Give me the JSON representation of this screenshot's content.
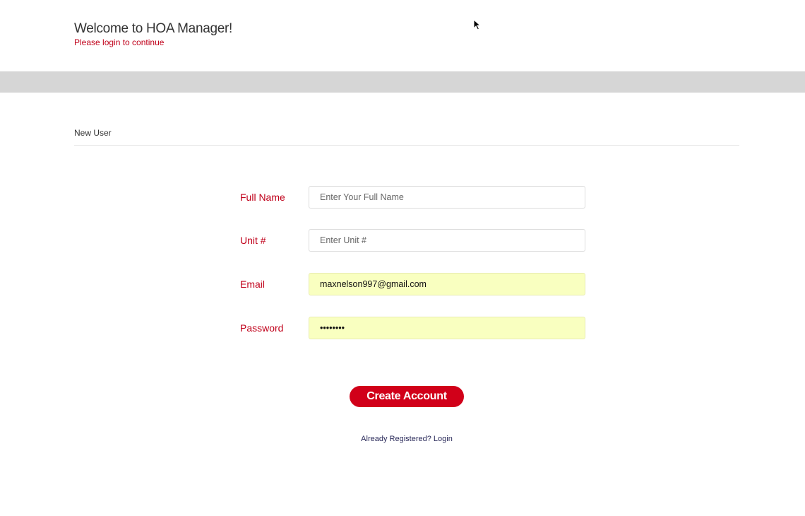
{
  "header": {
    "title": "Welcome to HOA Manager!",
    "subtitle": "Please login to continue"
  },
  "section": {
    "heading": "New User"
  },
  "form": {
    "full_name": {
      "label": "Full Name",
      "placeholder": "Enter Your Full Name",
      "value": ""
    },
    "unit": {
      "label": "Unit #",
      "placeholder": "Enter Unit #",
      "value": ""
    },
    "email": {
      "label": "Email",
      "placeholder": "",
      "value": "maxnelson997@gmail.com"
    },
    "password": {
      "label": "Password",
      "placeholder": "",
      "value": "••••••••"
    },
    "submit_label": "Create Account"
  },
  "footer": {
    "login_link": "Already Registered? Login"
  },
  "colors": {
    "accent": "#d10019",
    "label": "#c0001a",
    "autofill_bg": "#f9ffc0",
    "bar_gray": "#d6d6d6"
  }
}
